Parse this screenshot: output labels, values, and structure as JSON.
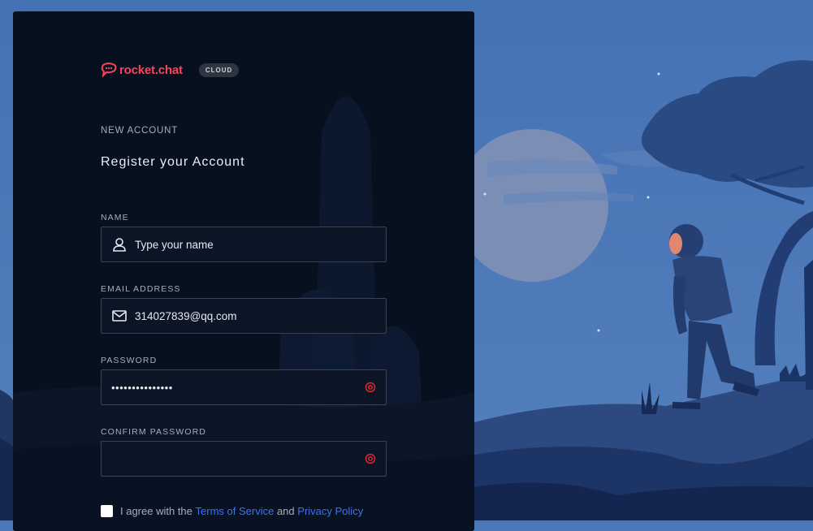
{
  "brand": {
    "name": "rocket.chat",
    "badge": "CLOUD"
  },
  "form": {
    "kicker": "NEW ACCOUNT",
    "title": "Register your Account",
    "name": {
      "label": "NAME",
      "placeholder": "Type your name",
      "icon": "user-icon"
    },
    "email": {
      "label": "EMAIL ADDRESS",
      "value": "314027839@qq.com",
      "icon": "mail-icon"
    },
    "password": {
      "label": "PASSWORD",
      "value": "•••••••••••••••",
      "icon": "eye-icon"
    },
    "confirm": {
      "label": "CONFIRM PASSWORD",
      "value": "",
      "icon": "eye-icon"
    },
    "agree": {
      "prefix": "I agree with the",
      "terms": "Terms of Service",
      "and": "and",
      "privacy": "Privacy Policy"
    }
  },
  "colors": {
    "brand": "#f5455c",
    "link": "#3a73f0",
    "panel": "#07101f",
    "sky": "#4a78b8"
  }
}
